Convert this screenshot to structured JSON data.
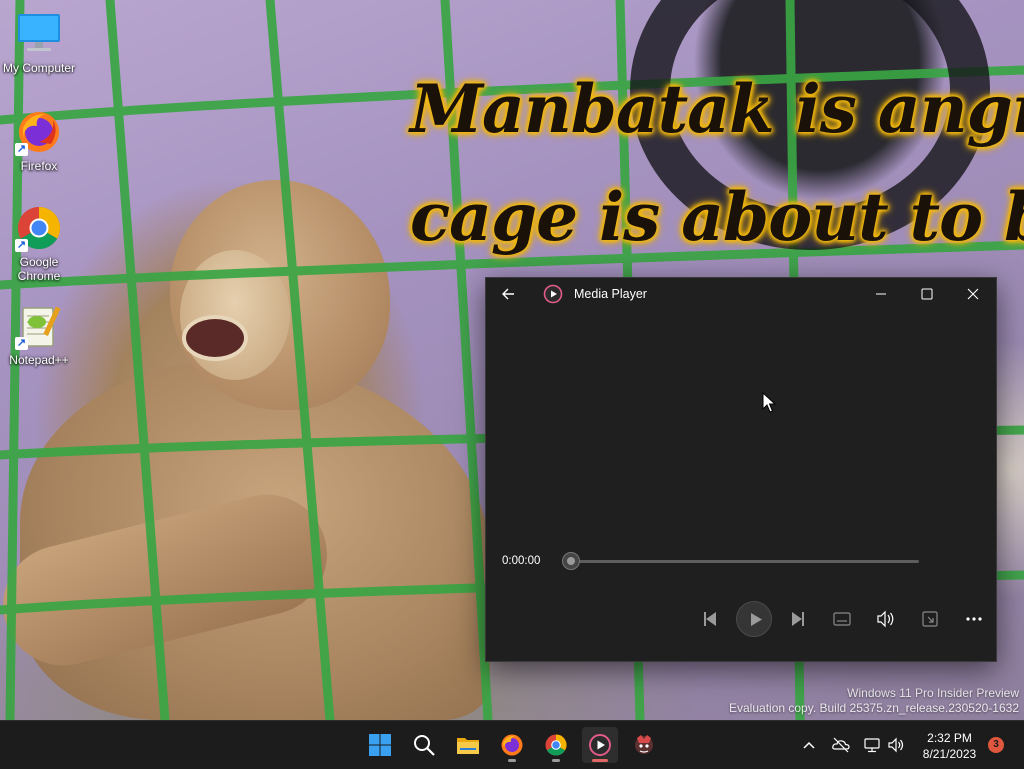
{
  "desktop": {
    "caption_line1": "Manbatak is angry the",
    "caption_line2": "cage is about to be pai",
    "icons": [
      {
        "label": "My Computer",
        "icon": "computer-icon"
      },
      {
        "label": "Firefox",
        "icon": "firefox-icon"
      },
      {
        "label": "Google Chrome",
        "icon": "chrome-icon"
      },
      {
        "label": "Notepad++",
        "icon": "notepadpp-icon"
      }
    ],
    "watermark_line1": "Windows 11 Pro Insider Preview",
    "watermark_line2": "Evaluation copy. Build 25375.zn_release.230520-1632"
  },
  "media_player": {
    "title": "Media Player",
    "time": "0:00:00",
    "progress_percent": 0,
    "controls": [
      "previous",
      "play",
      "next",
      "captions",
      "volume",
      "mini-view",
      "more"
    ]
  },
  "taskbar": {
    "items": [
      "start",
      "search",
      "file-explorer",
      "firefox",
      "chrome",
      "media-player",
      "app"
    ],
    "active": "media-player",
    "clock_time": "2:32 PM",
    "clock_date": "8/21/2023",
    "notification_count": "3"
  },
  "colors": {
    "cage_green": "#3aa544",
    "caption_glow": "#f1b80f",
    "window_bg": "#1f1f1f",
    "taskbar_bg": "#1c1c1c",
    "active_indicator": "#e06666"
  }
}
